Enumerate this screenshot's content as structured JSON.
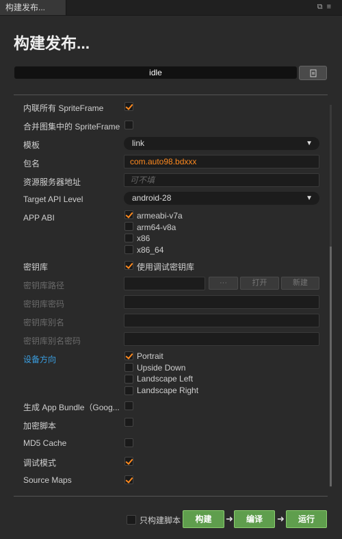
{
  "tab": {
    "label": "构建发布...",
    "icons": [
      "restore-icon",
      "menu-icon"
    ]
  },
  "title": "构建发布...",
  "status": "idle",
  "settings": {
    "inline_spriteframe": {
      "label": "内联所有 SpriteFrame",
      "checked": true
    },
    "merge_atlas": {
      "label": "合并图集中的 SpriteFrame",
      "checked": false
    },
    "template": {
      "label": "模板",
      "value": "link"
    },
    "package_name": {
      "label": "包名",
      "value": "com.auto98.bdxxx"
    },
    "resource_server": {
      "label": "资源服务器地址",
      "placeholder": "可不填"
    },
    "target_api": {
      "label": "Target API Level",
      "value": "android-28"
    },
    "app_abi": {
      "label": "APP ABI",
      "options": [
        {
          "label": "armeabi-v7a",
          "checked": true
        },
        {
          "label": "arm64-v8a",
          "checked": false
        },
        {
          "label": "x86",
          "checked": false
        },
        {
          "label": "x86_64",
          "checked": false
        }
      ]
    },
    "keystore": {
      "label": "密钥库",
      "option_label": "使用调试密钥库",
      "checked": true
    },
    "keystore_path": {
      "label": "密钥库路径",
      "browse": "···",
      "open": "打开",
      "new": "新建"
    },
    "keystore_password": {
      "label": "密钥库密码"
    },
    "keystore_alias": {
      "label": "密钥库别名"
    },
    "keystore_alias_password": {
      "label": "密钥库别名密码"
    },
    "orientation": {
      "label": "设备方向",
      "options": [
        {
          "label": "Portrait",
          "checked": true
        },
        {
          "label": "Upside Down",
          "checked": false
        },
        {
          "label": "Landscape Left",
          "checked": false
        },
        {
          "label": "Landscape Right",
          "checked": false
        }
      ]
    },
    "app_bundle": {
      "label": "生成 App Bundle（Goog...",
      "checked": false
    },
    "encrypt_js": {
      "label": "加密脚本",
      "checked": false
    },
    "md5_cache": {
      "label": "MD5 Cache",
      "checked": false
    },
    "debug_mode": {
      "label": "调试模式",
      "checked": true
    },
    "source_maps": {
      "label": "Source Maps",
      "checked": true
    }
  },
  "footer": {
    "build_script_only": {
      "label": "只构建脚本",
      "checked": false
    },
    "build": "构建",
    "compile": "编译",
    "run": "运行"
  },
  "colors": {
    "accent": "#ff8a1f",
    "link_blue": "#3a9ee0",
    "button_green": "#5f9e4d"
  }
}
